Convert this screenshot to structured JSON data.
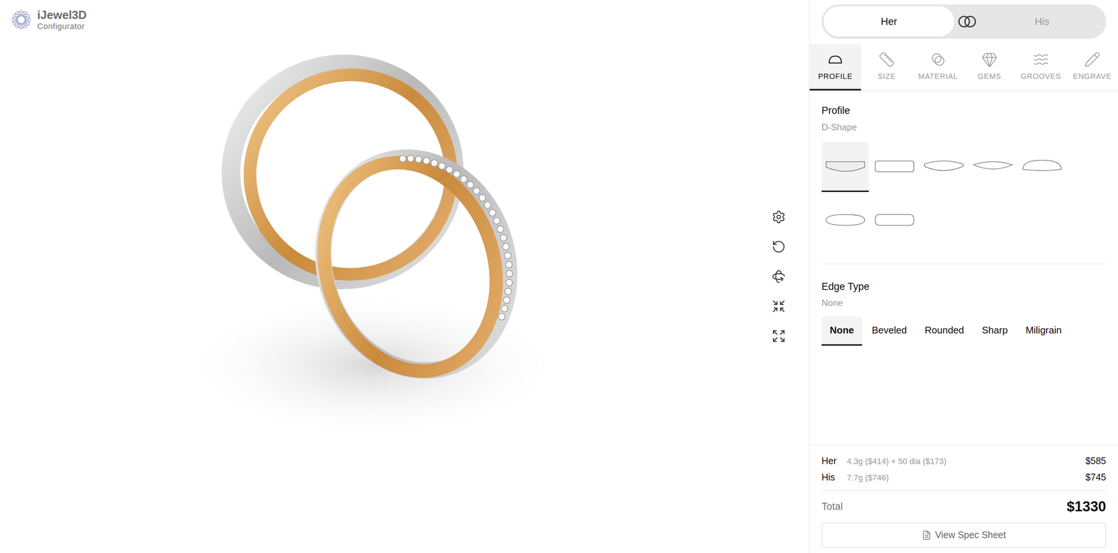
{
  "logo": {
    "name": "iJewel3D",
    "subtitle": "Configurator"
  },
  "toggle": [
    {
      "label": "Her",
      "selected": true
    },
    {
      "label": "His",
      "selected": false
    }
  ],
  "tabs": [
    {
      "label": "PROFILE",
      "kind": "profile",
      "selected": true
    },
    {
      "label": "SIZE",
      "kind": "size",
      "selected": false
    },
    {
      "label": "MATERIAL",
      "kind": "material",
      "selected": false
    },
    {
      "label": "GEMS",
      "kind": "gems",
      "selected": false
    },
    {
      "label": "GROOVES",
      "kind": "grooves",
      "selected": false
    },
    {
      "label": "ENGRAVE",
      "kind": "engrave",
      "selected": false
    }
  ],
  "profile": {
    "title": "Profile",
    "value": "D-Shape",
    "options": [
      {
        "kind": "dshape",
        "selected": true
      },
      {
        "kind": "flat",
        "selected": false
      },
      {
        "kind": "court",
        "selected": false
      },
      {
        "kind": "lens",
        "selected": false
      },
      {
        "kind": "dome",
        "selected": false
      },
      {
        "kind": "oval",
        "selected": false
      },
      {
        "kind": "rounded",
        "selected": false
      }
    ]
  },
  "edge": {
    "title": "Edge Type",
    "value": "None",
    "options": [
      {
        "label": "None",
        "selected": true
      },
      {
        "label": "Beveled",
        "selected": false
      },
      {
        "label": "Rounded",
        "selected": false
      },
      {
        "label": "Sharp",
        "selected": false
      },
      {
        "label": "Miligrain",
        "selected": false
      }
    ]
  },
  "summary": {
    "rows": [
      {
        "label": "Her",
        "detail": "4.3g ($414) + 50 dia ($173)",
        "price": "$585"
      },
      {
        "label": "His",
        "detail": "7.7g ($746)",
        "price": "$745"
      }
    ],
    "total": {
      "label": "Total",
      "amount": "$1330"
    },
    "button": "View Spec Sheet"
  }
}
